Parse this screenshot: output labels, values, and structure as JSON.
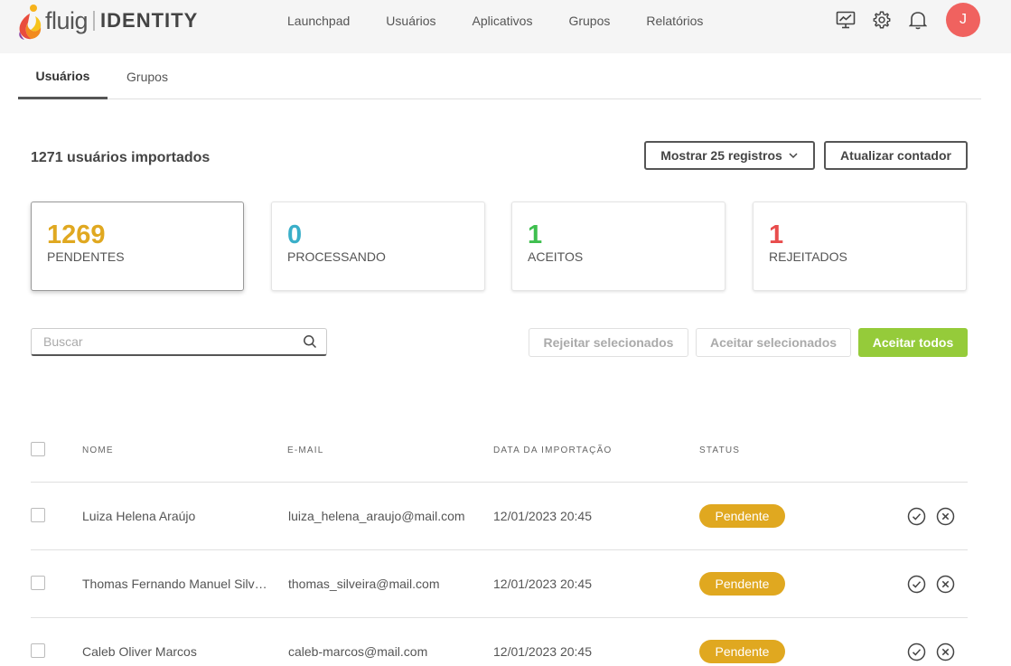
{
  "header": {
    "logo_text": "fluig",
    "logo_product": "IDENTITY",
    "nav": [
      "Launchpad",
      "Usuários",
      "Aplicativos",
      "Grupos",
      "Relatórios"
    ],
    "icons": [
      "monitor-chart-icon",
      "gear-icon",
      "bell-icon"
    ],
    "avatar_initial": "J",
    "avatar_color": "#f0625f"
  },
  "tabs": [
    {
      "label": "Usuários",
      "active": true
    },
    {
      "label": "Grupos",
      "active": false
    }
  ],
  "summary": {
    "imported_label": "1271 usuários importados",
    "show_records_label": "Mostrar 25 registros",
    "refresh_label": "Atualizar contador"
  },
  "cards": [
    {
      "value": "1269",
      "label": "PENDENTES",
      "color": "#e0a820",
      "selected": true
    },
    {
      "value": "0",
      "label": "PROCESSANDO",
      "color": "#3aafc9",
      "selected": false
    },
    {
      "value": "1",
      "label": "ACEITOS",
      "color": "#3fbf4f",
      "selected": false
    },
    {
      "value": "1",
      "label": "REJEITADOS",
      "color": "#e84c4c",
      "selected": false
    }
  ],
  "search": {
    "placeholder": "Buscar",
    "value": ""
  },
  "actions": {
    "reject_selected": "Rejeitar selecionados",
    "accept_selected": "Aceitar selecionados",
    "accept_all": "Aceitar todos",
    "accent_color": "#95cb3a"
  },
  "table": {
    "columns": [
      "NOME",
      "E-MAIL",
      "DATA DA IMPORTAÇÃO",
      "STATUS"
    ],
    "rows": [
      {
        "name": "Luiza Helena Araújo",
        "email": "luiza_helena_araujo@mail.com",
        "date": "12/01/2023 20:45",
        "status": "Pendente"
      },
      {
        "name": "Thomas Fernando Manuel Silveira",
        "email": "thomas_silveira@mail.com",
        "date": "12/01/2023 20:45",
        "status": "Pendente"
      },
      {
        "name": "Caleb Oliver Marcos",
        "email": "caleb-marcos@mail.com",
        "date": "12/01/2023 20:45",
        "status": "Pendente"
      }
    ]
  }
}
